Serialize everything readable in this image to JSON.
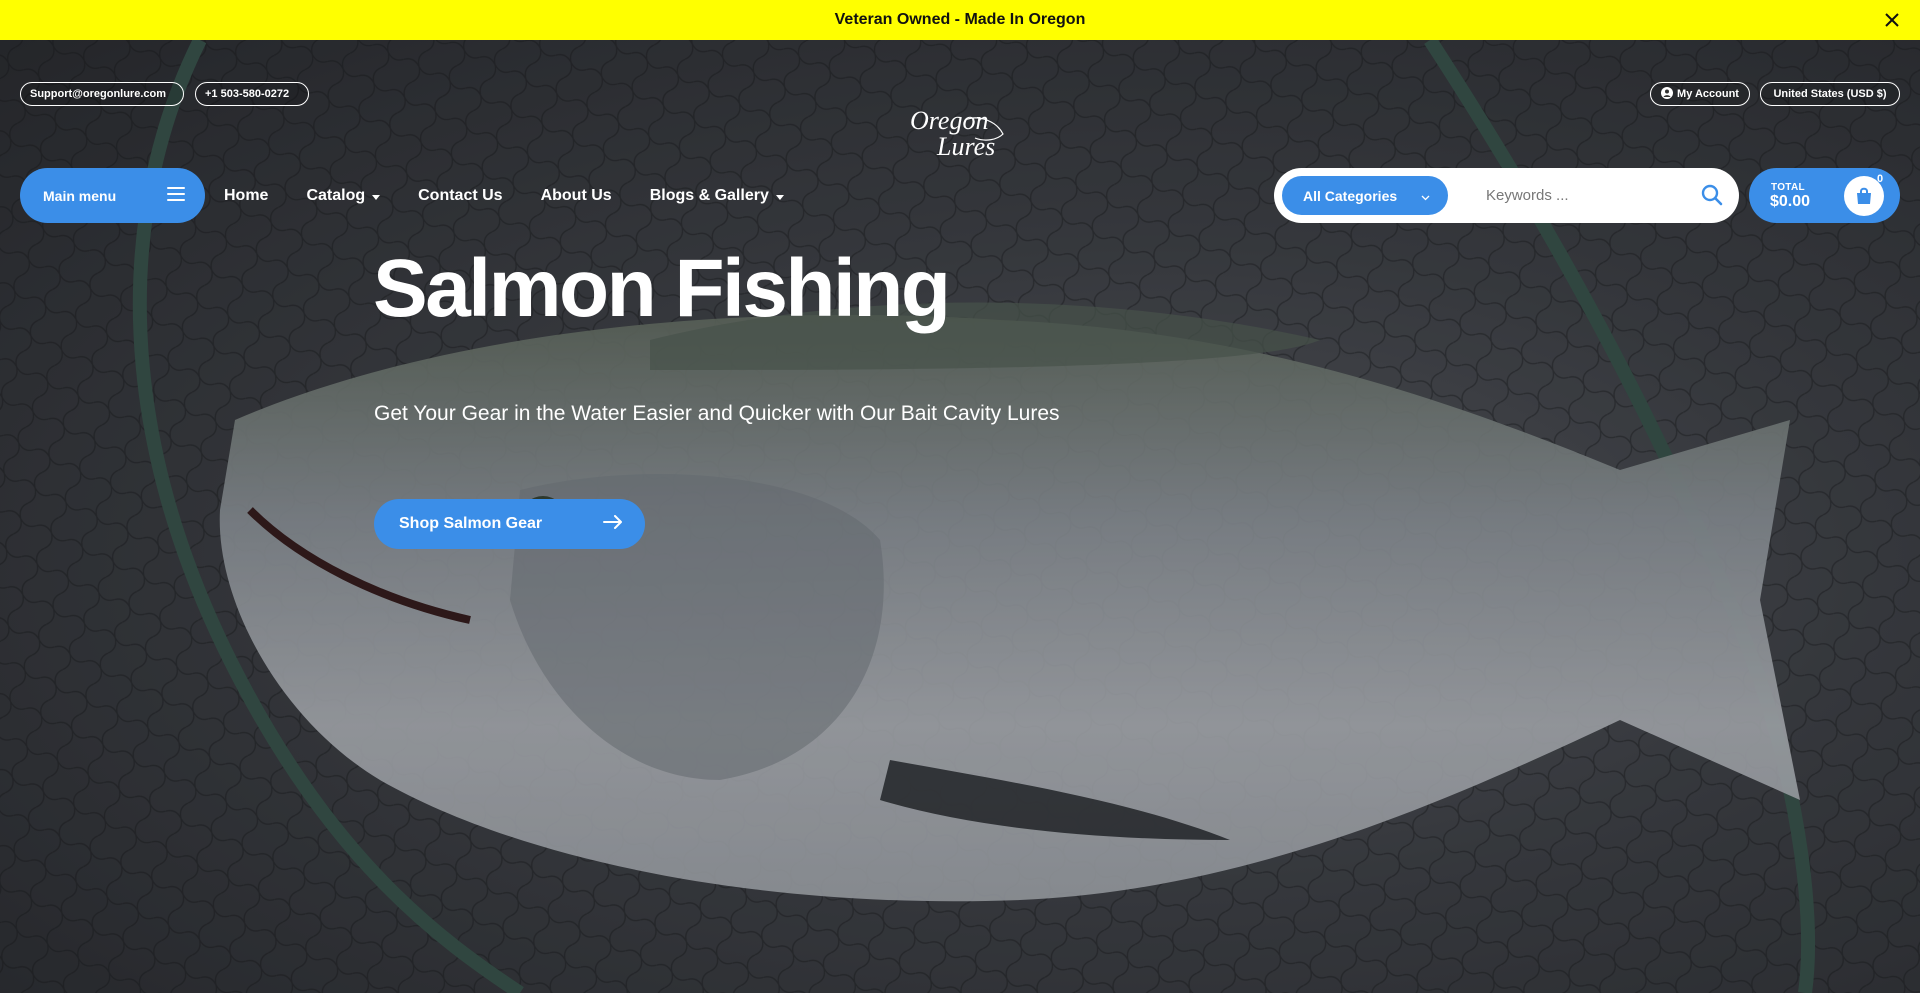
{
  "announcement": {
    "text": "Veteran Owned - Made In Oregon",
    "close_icon": "close-icon"
  },
  "contact": {
    "email": "Support@oregonlure.com",
    "phone": "+1 503-580-0272"
  },
  "brand": {
    "logo_line1": "Oregon",
    "logo_line2": "Lures"
  },
  "account": {
    "label": "My Account",
    "currency": "United States (USD $)"
  },
  "nav": {
    "main_menu_label": "Main menu",
    "items": [
      {
        "label": "Home",
        "has_dropdown": false
      },
      {
        "label": "Catalog",
        "has_dropdown": true
      },
      {
        "label": "Contact Us",
        "has_dropdown": false
      },
      {
        "label": "About Us",
        "has_dropdown": false
      },
      {
        "label": "Blogs & Gallery",
        "has_dropdown": true
      }
    ]
  },
  "search": {
    "category": "All Categories",
    "placeholder": "Keywords ..."
  },
  "cart": {
    "label": "TOTAL",
    "total": "$0.00",
    "count": "0"
  },
  "hero": {
    "title": "Salmon Fishing",
    "subtitle": "Get Your Gear in the Water Easier and Quicker with Our Bait Cavity Lures",
    "cta_label": "Shop Salmon Gear"
  },
  "colors": {
    "announcement_bg": "#ffff00",
    "accent_blue": "#3b8ee8"
  }
}
